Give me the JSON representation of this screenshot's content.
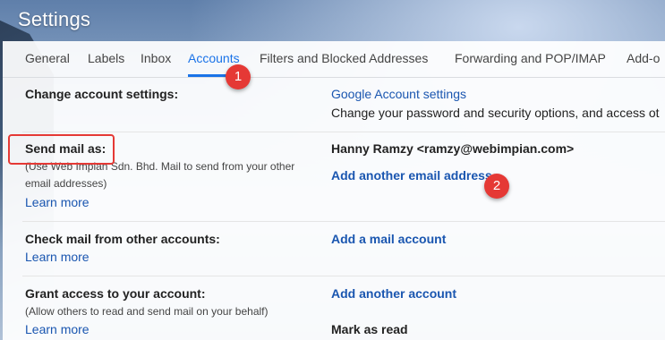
{
  "app": {
    "title": "Settings"
  },
  "tabs": [
    {
      "label": "General"
    },
    {
      "label": "Labels"
    },
    {
      "label": "Inbox"
    },
    {
      "label": "Accounts"
    },
    {
      "label": "Filters and Blocked Addresses"
    },
    {
      "label": "Forwarding and POP/IMAP"
    },
    {
      "label": "Add-o"
    }
  ],
  "sections": {
    "change_account": {
      "label": "Change account settings:",
      "link": "Google Account settings",
      "description": "Change your password and security options, and access ot"
    },
    "send_mail": {
      "label": "Send mail as:",
      "sub_line1": "(Use Web Impian Sdn. Bhd. Mail to send from your other",
      "sub_line2": "email addresses)",
      "learn_more": "Learn more",
      "identity": "Hanny Ramzy <ramzy@webimpian.com>",
      "add_link": "Add another email address"
    },
    "check_mail": {
      "label": "Check mail from other accounts:",
      "learn_more": "Learn more",
      "add_link": "Add a mail account"
    },
    "grant_access": {
      "label": "Grant access to your account:",
      "sub_line1": "(Allow others to read and send mail on your behalf)",
      "learn_more": "Learn more",
      "add_link": "Add another account",
      "mark_read": "Mark as read"
    }
  },
  "callouts": {
    "one": "1",
    "two": "2",
    "color": "#e53935"
  }
}
